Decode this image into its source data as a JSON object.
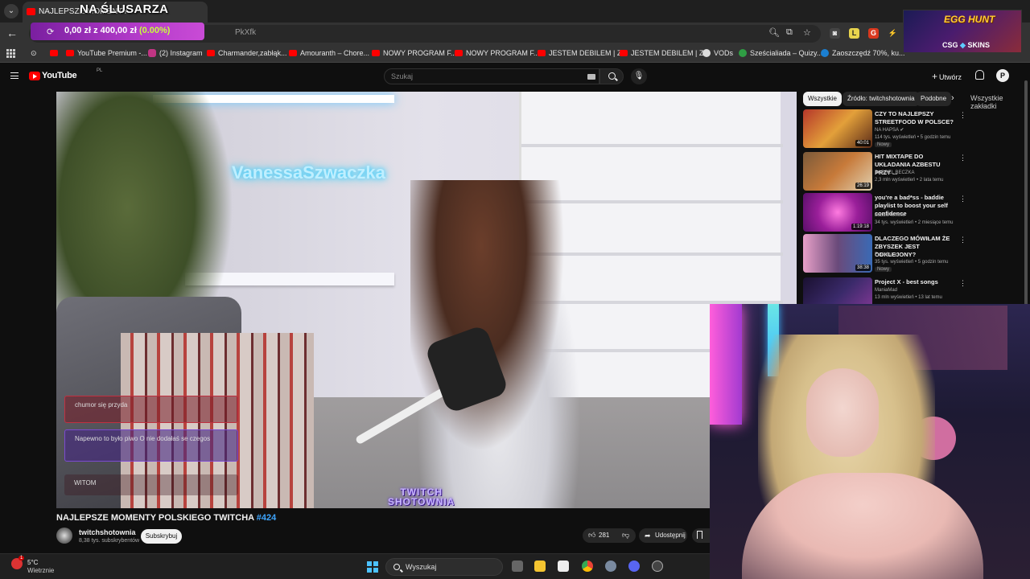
{
  "browser": {
    "tab_title": "NAJLEPSZE MOMENTY",
    "url_fragment": "PkXfk",
    "bookmarks": [
      "YouTube Premium -...",
      "(2) Instagram",
      "Charmander,zabłąk...",
      "Amouranth – Chore...",
      "NOWY PROGRAM F...",
      "NOWY PROGRAM F...",
      "JESTEM DEBILEM | Z...",
      "JESTEM DEBILEM | Z...",
      "VODs",
      "Sześcialiada – Quizy...",
      "Zaoszczędź 70%, ku..."
    ],
    "bookmarks_right": "Wszystkie zakładki"
  },
  "stream_overlay": {
    "title": "NA ŚLUSARZA",
    "donation_amount": "0,00 zł z 400,00 zł",
    "donation_percent": "(0.00%)",
    "promo_title": "EGG HUNT",
    "promo_brand_a": "CSG",
    "promo_brand_b": "SKINS"
  },
  "youtube": {
    "logo_text": "YouTube",
    "region": "PL",
    "search_placeholder": "Szukaj",
    "create_label": "Utwórz",
    "avatar_letter": "P"
  },
  "video": {
    "neon_sign": "VanessaSzwaczka",
    "watermark_line1": "TWITCH",
    "watermark_line2": "SHOTOWNIA",
    "chat": [
      {
        "user": "",
        "text": "chumor się przyda"
      },
      {
        "user": "",
        "text": "Napewno to było piwo O nie dodałaś se czegos"
      },
      {
        "user": "",
        "text": "WITOM"
      }
    ],
    "title": "NAJLEPSZE MOMENTY POLSKIEGO TWITCHA",
    "title_tag": "#424",
    "channel_name": "twitchshotownia",
    "channel_subs": "8,38 tys. subskrybentów",
    "subscribe_label": "Subskrybuj",
    "likes": "281",
    "share_label": "Udostępnij"
  },
  "sidebar": {
    "chips": [
      "Wszystkie",
      "Źródło: twitchshotownia",
      "Podobne"
    ],
    "related": [
      {
        "title": "CZY TO NAJLEPSZY STREETFOOD W POLSCE?",
        "channel": "NA HAPSA",
        "meta": "114 tys. wyświetleń • 5 godzin temu",
        "badge": "Nowy",
        "duration": "40:01"
      },
      {
        "title": "HIT MIXTAPE DO UKŁADANIA AZBESTU PRZY ...",
        "channel": "BARREL BECZKA",
        "meta": "2,3 mln wyświetleń • 2 lata temu",
        "badge": "",
        "duration": "26:19"
      },
      {
        "title": "you're a bad*ss - baddie playlist to boost your self confidence",
        "channel": "baddie femme",
        "meta": "34 tys. wyświetleń • 2 miesiące temu",
        "badge": "",
        "duration": "1:19:18"
      },
      {
        "title": "DLACZEGO MÓWIŁAM ŻE ZBYSZEK JEST ODKLEJONY?",
        "channel": "Fusialka",
        "meta": "35 tys. wyświetleń • 5 godzin temu",
        "badge": "Nowy",
        "duration": "38:38"
      },
      {
        "title": "Project X - best songs",
        "channel": "ManiaMad",
        "meta": "13 mln wyświetleń • 13 lat temu",
        "badge": "",
        "duration": ""
      }
    ]
  },
  "taskbar": {
    "temperature": "5°C",
    "weather": "Wietrznie",
    "search_label": "Wyszukaj"
  }
}
